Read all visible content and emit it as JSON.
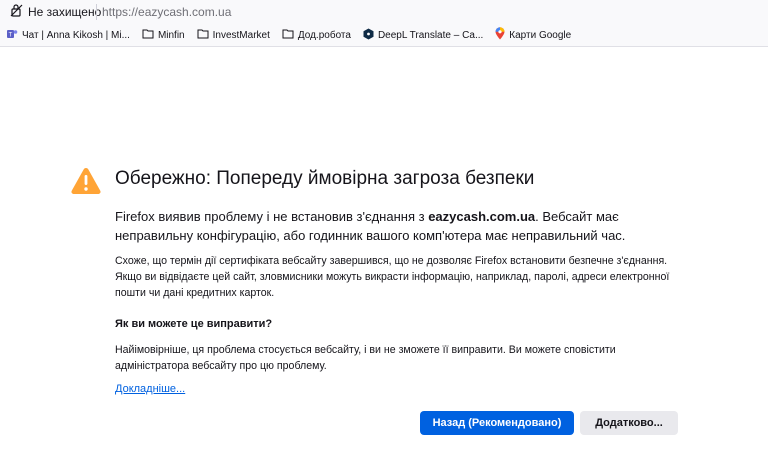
{
  "urlbar": {
    "security_label": "Не захищено",
    "url": "https://eazycash.com.ua"
  },
  "bookmarks": [
    {
      "label": "Чат | Anna Kikosh | Mi...",
      "icon": "teams-icon"
    },
    {
      "label": "Minfin",
      "icon": "folder-icon"
    },
    {
      "label": "InvestMarket",
      "icon": "folder-icon"
    },
    {
      "label": "Дод.робота",
      "icon": "folder-icon"
    },
    {
      "label": "DeepL Translate – Са...",
      "icon": "deepl-icon"
    },
    {
      "label": "Карти Google",
      "icon": "maps-pin-icon"
    }
  ],
  "error": {
    "title": "Обережно: Попереду ймовірна загроза безпеки",
    "intro_before": "Firefox виявив проблему і не встановив з'єднання з ",
    "intro_host": "eazycash.com.ua",
    "intro_after": ". Вебсайт має неправильну конфігурацію, або годинник вашого комп'ютера має неправильний час.",
    "details": "Схоже, що термін дії сертифіката вебсайту завершився, що не дозволяє Firefox встановити безпечне з'єднання. Якщо ви відвідаєте цей сайт, зловмисники можуть викрасти інформацію, наприклад, паролі, адреси електронної пошти чи дані кредитних карток.",
    "fix_heading": "Як ви можете це виправити?",
    "fix_text": "Найімовірніше, ця проблема стосується вебсайту, і ви не зможете її виправити. Ви можете сповістити адміністратора вебсайту про цю проблему.",
    "learn_more": "Докладніше...",
    "back_button": "Назад (Рекомендовано)",
    "advanced_button": "Додатково..."
  },
  "colors": {
    "accent": "#0061e0",
    "warning": "#ffa436",
    "text": "#15141a"
  }
}
